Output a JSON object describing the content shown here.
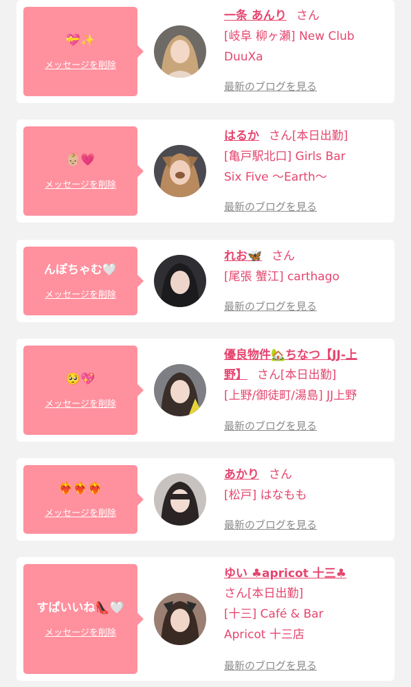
{
  "common": {
    "delete_label": "メッセージを削除",
    "blog_label": "最新のブログを見る"
  },
  "cards": [
    {
      "message": "💝✨",
      "name": "一条 あんり",
      "suffix": "さん",
      "shop_line1": "[岐阜 柳ヶ瀬] New Club",
      "shop_line2": "DuuXa"
    },
    {
      "message": "👶🏼💗",
      "name": "はるか",
      "suffix": "さん[本日出勤]",
      "shop_line1": "[亀戸駅北口] Girls Bar",
      "shop_line2": "Six Five 〜Earth〜"
    },
    {
      "message": "んぽちゃむ🤍",
      "name": "れお🦋",
      "suffix": "さん",
      "shop_line1": "[尾張 蟹江] carthago",
      "shop_line2": ""
    },
    {
      "message": "🥺💖",
      "name_line1": "優良物件🏡ちなつ【JJ-上",
      "name_line2": "野】",
      "suffix": "さん[本日出勤]",
      "shop_line1": "[上野/御徒町/湯島] JJ上野",
      "shop_line2": ""
    },
    {
      "message": "❤️‍🔥❤️‍🔥❤️‍🔥",
      "name": "あかり",
      "suffix": "さん",
      "shop_line1": "[松戸] はなもも",
      "shop_line2": ""
    },
    {
      "message": "すぱいいね👠🤍",
      "name": "ゆい ♣apricot 十三♣",
      "suffix": "さん[本日出勤]",
      "shop_line1": "[十三] Café & Bar",
      "shop_line2": "Apricot 十三店"
    }
  ]
}
